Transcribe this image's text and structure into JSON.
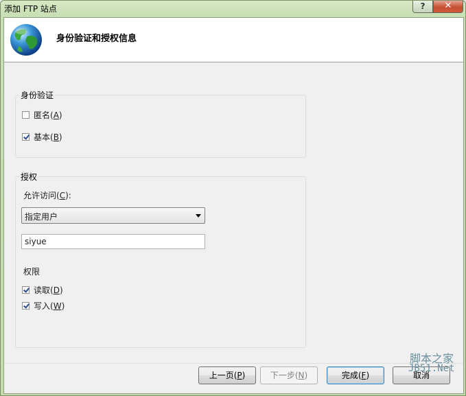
{
  "window": {
    "title": "添加 FTP 站点",
    "help_label": "?",
    "close_label": "✕"
  },
  "header": {
    "icon": "globe-icon",
    "title": "身份验证和授权信息"
  },
  "authentication": {
    "legend": "身份验证",
    "anonymous": {
      "label_main": "匿名(",
      "label_key": "A",
      "label_end": ")",
      "checked": false
    },
    "basic": {
      "label_main": "基本(",
      "label_key": "B",
      "label_end": ")",
      "checked": true
    }
  },
  "authorization": {
    "legend": "授权",
    "allow_access": {
      "label_main": "允许访问(",
      "label_key": "C",
      "label_end": "):"
    },
    "allow_access_selected": "指定用户",
    "user_value": "siyue",
    "permissions_label": "权限",
    "read": {
      "label_main": "读取(",
      "label_key": "D",
      "label_end": ")",
      "checked": true
    },
    "write": {
      "label_main": "写入(",
      "label_key": "W",
      "label_end": ")",
      "checked": true
    }
  },
  "footer": {
    "prev": {
      "label_main": "上一页(",
      "label_key": "P",
      "label_end": ")"
    },
    "next": {
      "label_main": "下一步(",
      "label_key": "N",
      "label_end": ")"
    },
    "finish": {
      "label_main": "完成(",
      "label_key": "F",
      "label_end": ")"
    },
    "cancel": {
      "label": "取消"
    }
  },
  "watermark": {
    "line1": "脚本之家",
    "line2": "JB51.Net"
  }
}
